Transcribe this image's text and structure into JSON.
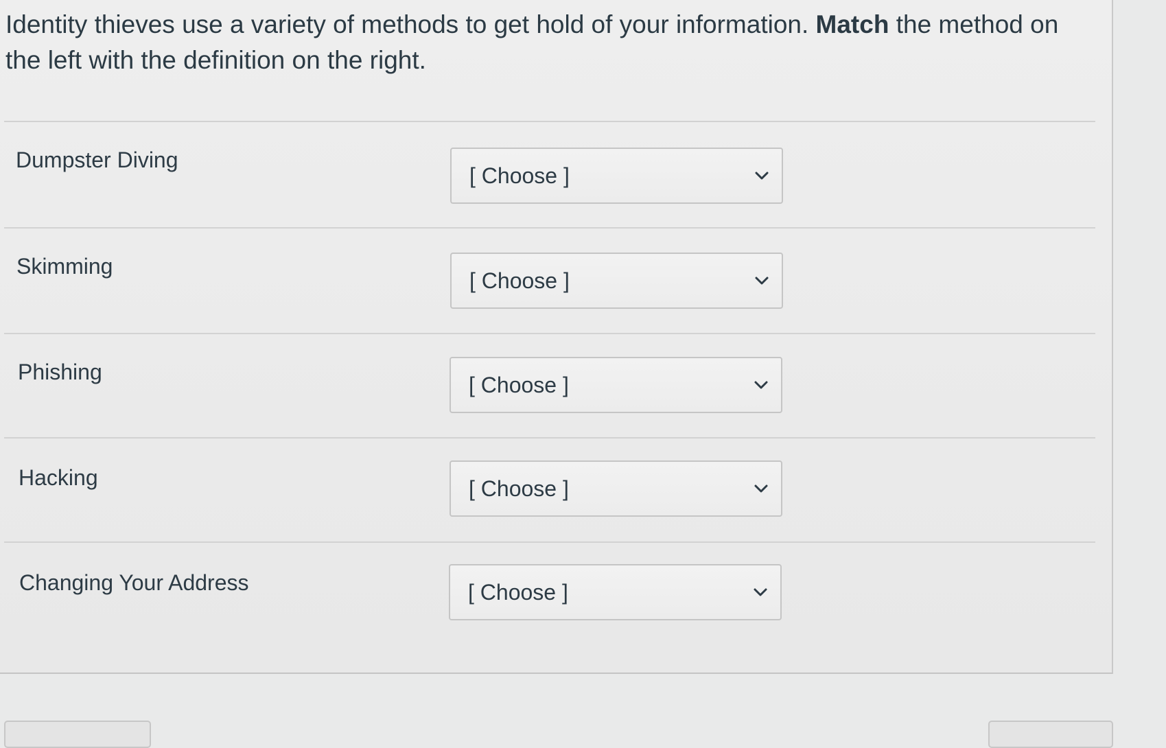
{
  "question": {
    "prompt_part1": "Identity thieves use a variety of methods to get hold of your information. ",
    "prompt_bold": "Match",
    "prompt_part2": " the method on the left with the definition on the right."
  },
  "rows": [
    {
      "label": "Dumpster Diving",
      "selected": "[ Choose ]"
    },
    {
      "label": "Skimming",
      "selected": "[ Choose ]"
    },
    {
      "label": "Phishing",
      "selected": "[ Choose ]"
    },
    {
      "label": "Hacking",
      "selected": "[ Choose ]"
    },
    {
      "label": "Changing Your Address",
      "selected": "[ Choose ]"
    }
  ],
  "icons": {
    "dropdown": "chevron-down-icon"
  }
}
